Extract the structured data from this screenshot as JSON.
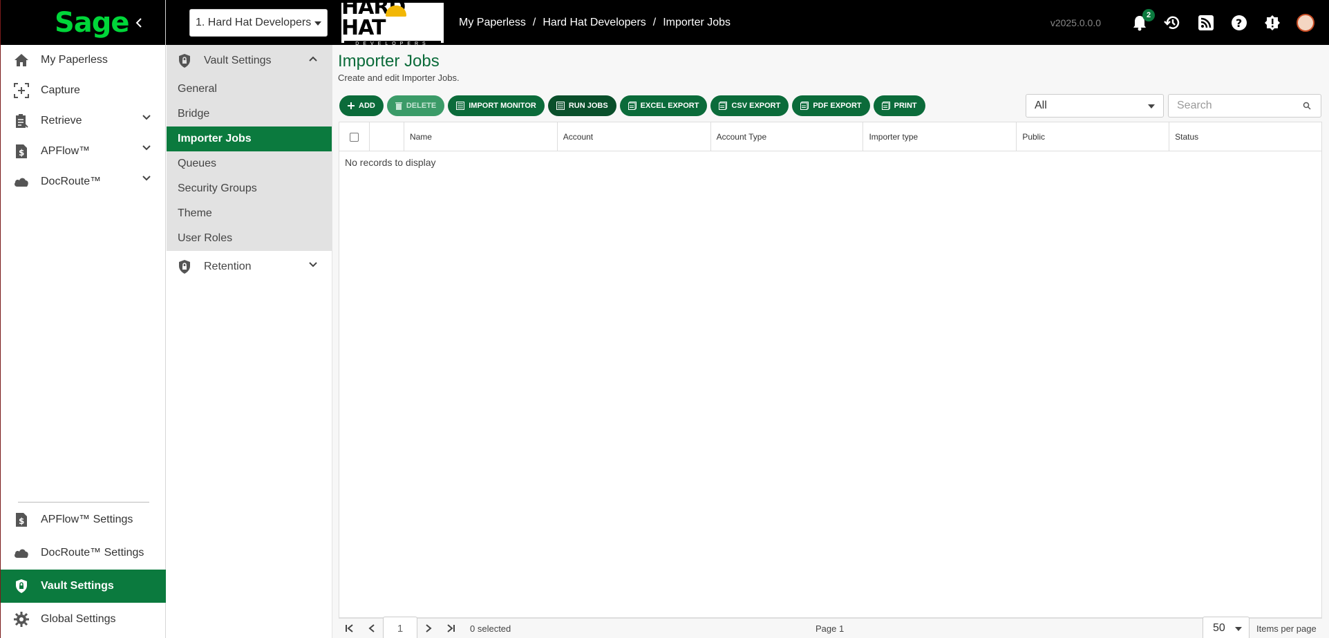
{
  "sidebar": {
    "logo": "Sage",
    "items": [
      {
        "label": "My Paperless",
        "icon": "home-icon"
      },
      {
        "label": "Capture",
        "icon": "capture-icon"
      },
      {
        "label": "Retrieve",
        "icon": "clipboard-icon"
      },
      {
        "label": "APFlow™",
        "icon": "dollar-doc-icon"
      },
      {
        "label": "DocRoute™",
        "icon": "cloud-icon"
      }
    ],
    "bottom_items": [
      {
        "label": "APFlow™ Settings",
        "icon": "dollar-doc-icon"
      },
      {
        "label": "DocRoute™ Settings",
        "icon": "cloud-icon"
      },
      {
        "label": "Vault Settings",
        "icon": "shield-lock-icon"
      },
      {
        "label": "Global Settings",
        "icon": "gear-icon"
      }
    ]
  },
  "header": {
    "vault_select": "1. Hard Hat Developers",
    "company_logo_top": "HARD HAT",
    "company_logo_bottom": "DEVELOPERS",
    "breadcrumb": [
      "My Paperless",
      "Hard Hat Developers",
      "Importer Jobs"
    ],
    "breadcrumb_sep": "/",
    "version": "v2025.0.0.0",
    "notifications_count": "2"
  },
  "subpanel": {
    "group_title": "Vault Settings",
    "items": [
      "General",
      "Bridge",
      "Importer Jobs",
      "Queues",
      "Security Groups",
      "Theme",
      "User Roles"
    ],
    "retention_title": "Retention"
  },
  "main": {
    "title": "Importer Jobs",
    "subtitle": "Create and edit Importer Jobs.",
    "toolbar": {
      "add": "ADD",
      "delete": "DELETE",
      "import_monitor": "IMPORT MONITOR",
      "run_jobs": "RUN JOBS",
      "excel_export": "EXCEL EXPORT",
      "csv_export": "CSV EXPORT",
      "pdf_export": "PDF EXPORT",
      "print": "PRINT"
    },
    "filter_value": "All",
    "search_placeholder": "Search",
    "columns": [
      "Name",
      "Account",
      "Account Type",
      "Importer type",
      "Public",
      "Status"
    ],
    "empty_message": "No records to display",
    "pager": {
      "page_input": "1",
      "selected": "0 selected",
      "page_info": "Page 1",
      "page_size": "50",
      "page_size_label": "Items per page"
    }
  },
  "colors": {
    "accent": "#0b7a3e",
    "header_bg": "#000000",
    "logo_green": "#00d639"
  }
}
